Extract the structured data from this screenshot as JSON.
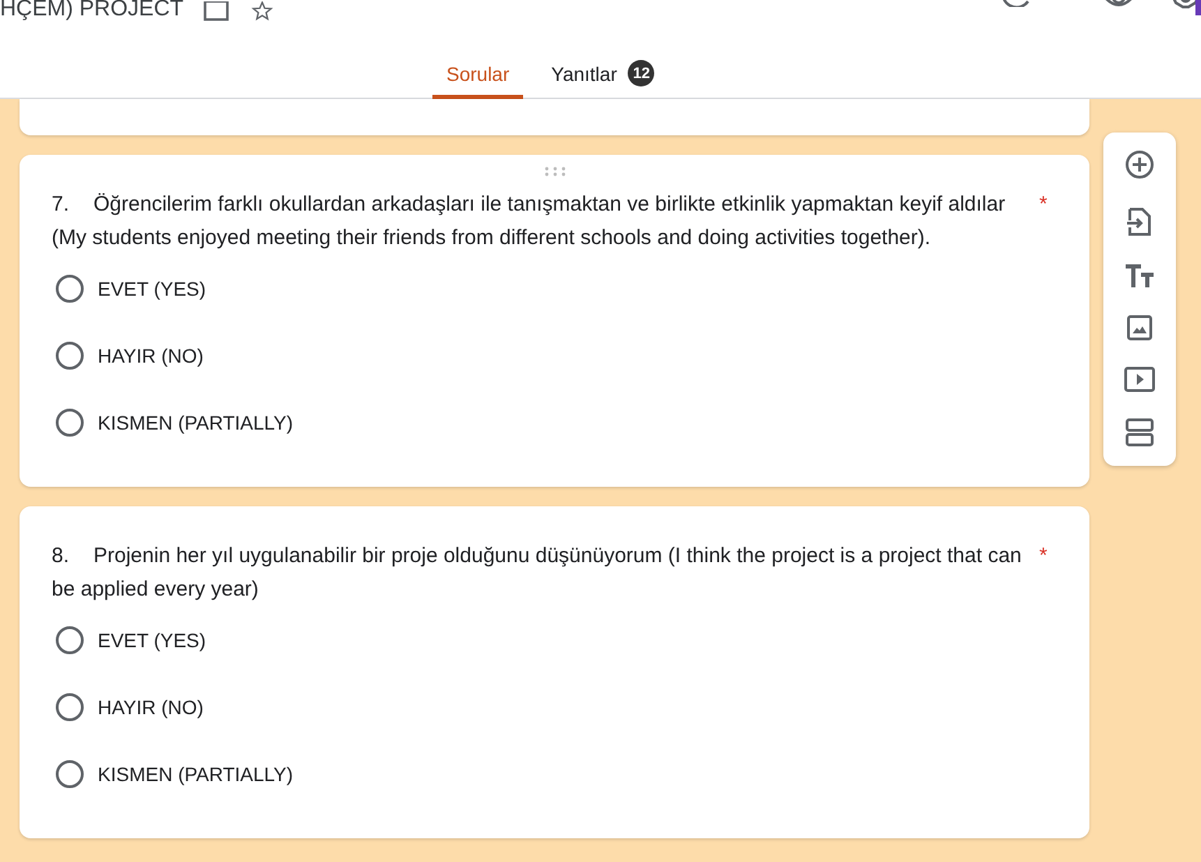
{
  "header": {
    "title": "HÇEM) PROJECT"
  },
  "tabs": [
    {
      "label": "Sorular",
      "selected": true
    },
    {
      "label": "Yanıtlar",
      "selected": false,
      "badge": "12"
    }
  ],
  "questions": [
    {
      "number": "7.",
      "text": "Öğrencilerim farklı okullardan arkadaşları ile tanışmaktan ve birlikte etkinlik yapmaktan keyif aldılar (My students enjoyed meeting their friends from different schools and doing activities together).",
      "required_mark": "*",
      "options": [
        {
          "label": "EVET (YES)",
          "selected": false
        },
        {
          "label": "HAYIR (NO)",
          "selected": false
        },
        {
          "label": "KISMEN (PARTIALLY)",
          "selected": false
        }
      ]
    },
    {
      "number": "8.",
      "text": "Projenin her yıl uygulanabilir bir proje olduğunu düşünüyorum (I think the project is a project that can be applied every year)",
      "required_mark": "*",
      "options": [
        {
          "label": "EVET (YES)",
          "selected": false
        },
        {
          "label": "HAYIR (NO)",
          "selected": false
        },
        {
          "label": "KISMEN (PARTIALLY)",
          "selected": false
        }
      ]
    }
  ]
}
